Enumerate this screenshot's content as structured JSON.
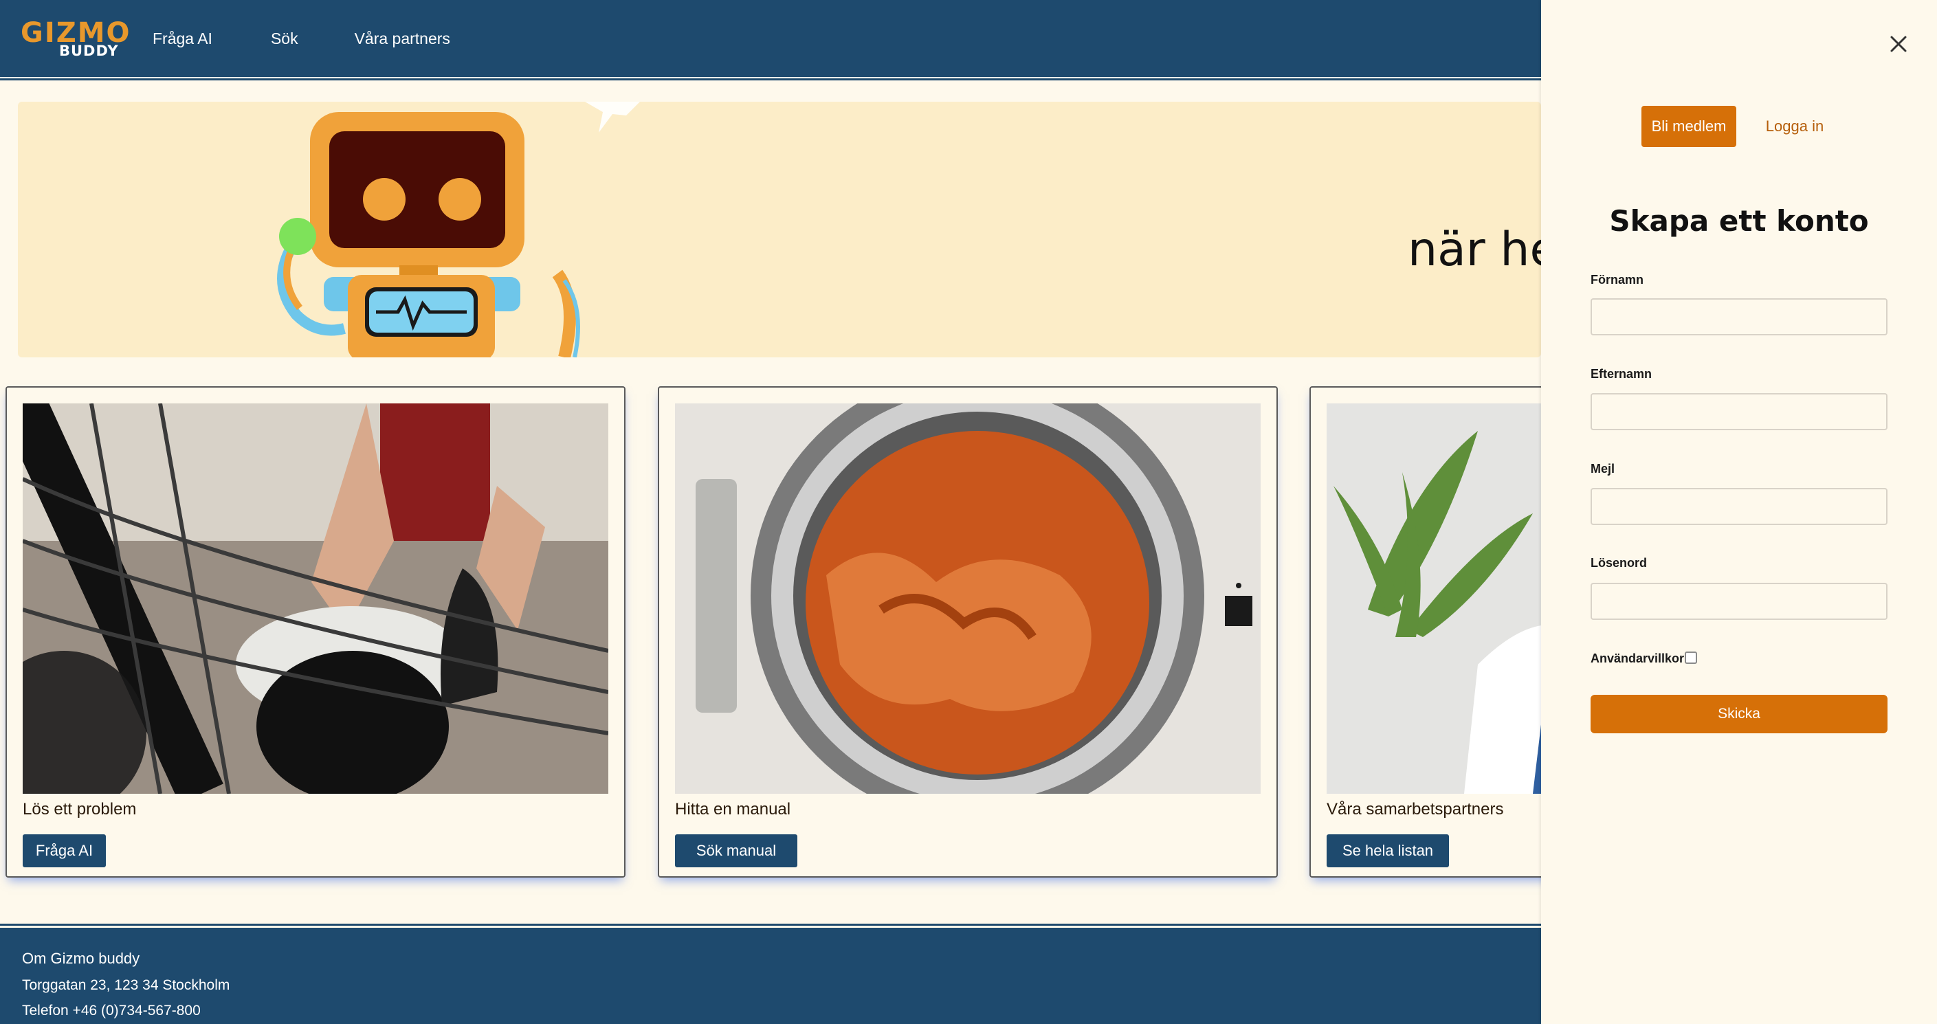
{
  "header": {
    "logo_top": "GIZMO",
    "logo_bottom": "BUDDY",
    "nav": [
      "Fråga AI",
      "Sök",
      "Våra partners"
    ]
  },
  "hero": {
    "text": "när hem"
  },
  "cards": [
    {
      "title": "Lös ett problem",
      "button": "Fråga AI",
      "image": "dishwasher-photo"
    },
    {
      "title": "Hitta en manual",
      "button": "Sök manual",
      "image": "washing-machine-photo"
    },
    {
      "title": "Våra samarbetspartners",
      "button": "Se hela listan",
      "image": "partners-photo"
    }
  ],
  "footer": {
    "about": "Om Gizmo buddy",
    "address": "Torggatan 23, 123 34 Stockholm",
    "phone": "Telefon +46 (0)734-567-800"
  },
  "panel": {
    "tab_active": "Bli medlem",
    "tab_inactive": "Logga in",
    "title": "Skapa ett konto",
    "fields": [
      "Förnamn",
      "Efternamn",
      "Mejl",
      "Lösenord"
    ],
    "checkbox_label": "Användarvillkor",
    "checkbox_checked": false,
    "submit": "Skicka"
  },
  "colors": {
    "navy": "#1e4a6e",
    "orange": "#d67008",
    "cream": "#fef9ec",
    "hero_bg": "#fcedc8",
    "logo_orange": "#e8982c"
  }
}
